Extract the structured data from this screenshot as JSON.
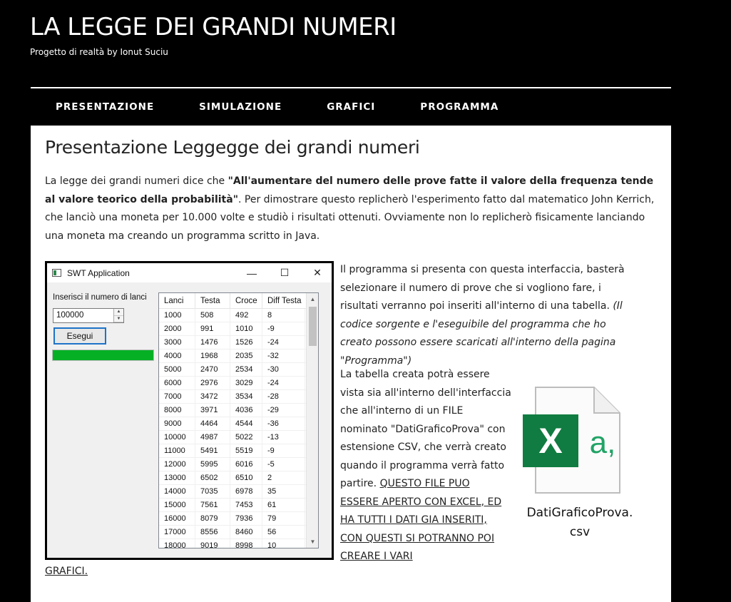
{
  "site": {
    "title": "LA LEGGE DEI GRANDI NUMERI",
    "subtitle": "Progetto di realtà by Ionut Suciu"
  },
  "nav": {
    "items": [
      {
        "label": "PRESENTAZIONE"
      },
      {
        "label": "SIMULAZIONE"
      },
      {
        "label": "GRAFICI"
      },
      {
        "label": "PROGRAMMA"
      }
    ]
  },
  "page": {
    "title": "Presentazione Leggegge dei grandi numeri",
    "intro_prefix": "La legge dei grandi numeri dice che ",
    "intro_bold": "\"All'aumentare del numero delle prove fatte il valore della frequenza tende al valore teorico della probabilità\"",
    "intro_suffix": ". Per dimostrare questo replicherò l'esperimento fatto dal matematico John Kerrich, che lanciò una moneta per 10.000 volte e studiò i risultati ottenuti. Ovviamente non lo replicherò fisicamente lanciando una moneta ma creando un programma scritto in Java.",
    "para1_text": "Il programma si presenta con questa interfaccia, basterà selezionare il numero di prove che si vogliono fare, i risultati verranno poi inseriti all'interno di una tabella. ",
    "para1_italic": "(Il codice sorgente e l'eseguibile del programma che ho creato possono essere scaricati all'interno della pagina \"Programma\")",
    "para2_text": "La tabella creata potrà essere vista sia all'interno dell'interfaccia che all'interno di un FILE nominato \"DatiGraficoProva\" con estensione CSV, che verrà creato quando il programma verrà fatto partire.",
    "para2_link": "QUESTO FILE PUO ESSERE APERTO CON EXCEL, ED HA TUTTI I DATI GIA INSERITI, CON QUESTI SI POTRANNO POI CREARE I VARI",
    "para2_link_tail": "GRAFICI.",
    "file_caption_line1": "DatiGraficoProva.",
    "file_caption_line2": "csv"
  },
  "swt": {
    "window_title": "SWT Application",
    "minimize": "—",
    "maximize": "☐",
    "close": "✕",
    "input_label": "Inserisci il numero di lanci",
    "spinner_value": "100000",
    "run_button": "Esegui",
    "progress_percent": 100,
    "progress_color": "#06b025",
    "columns": [
      "Lanci",
      "Testa",
      "Croce",
      "Diff Testa"
    ],
    "rows": [
      [
        "1000",
        "508",
        "492",
        "8"
      ],
      [
        "2000",
        "991",
        "1010",
        "-9"
      ],
      [
        "3000",
        "1476",
        "1526",
        "-24"
      ],
      [
        "4000",
        "1968",
        "2035",
        "-32"
      ],
      [
        "5000",
        "2470",
        "2534",
        "-30"
      ],
      [
        "6000",
        "2976",
        "3029",
        "-24"
      ],
      [
        "7000",
        "3472",
        "3534",
        "-28"
      ],
      [
        "8000",
        "3971",
        "4036",
        "-29"
      ],
      [
        "9000",
        "4464",
        "4544",
        "-36"
      ],
      [
        "10000",
        "4987",
        "5022",
        "-13"
      ],
      [
        "11000",
        "5491",
        "5519",
        "-9"
      ],
      [
        "12000",
        "5995",
        "6016",
        "-5"
      ],
      [
        "13000",
        "6502",
        "6510",
        "2"
      ],
      [
        "14000",
        "7035",
        "6978",
        "35"
      ],
      [
        "15000",
        "7561",
        "7453",
        "61"
      ],
      [
        "16000",
        "8079",
        "7936",
        "79"
      ],
      [
        "17000",
        "8556",
        "8460",
        "56"
      ],
      [
        "18000",
        "9019",
        "8998",
        "10"
      ]
    ]
  },
  "colors": {
    "background": "#000000",
    "content_bg": "#ffffff",
    "excel_green": "#107c41",
    "excel_light_green": "#21a366"
  }
}
